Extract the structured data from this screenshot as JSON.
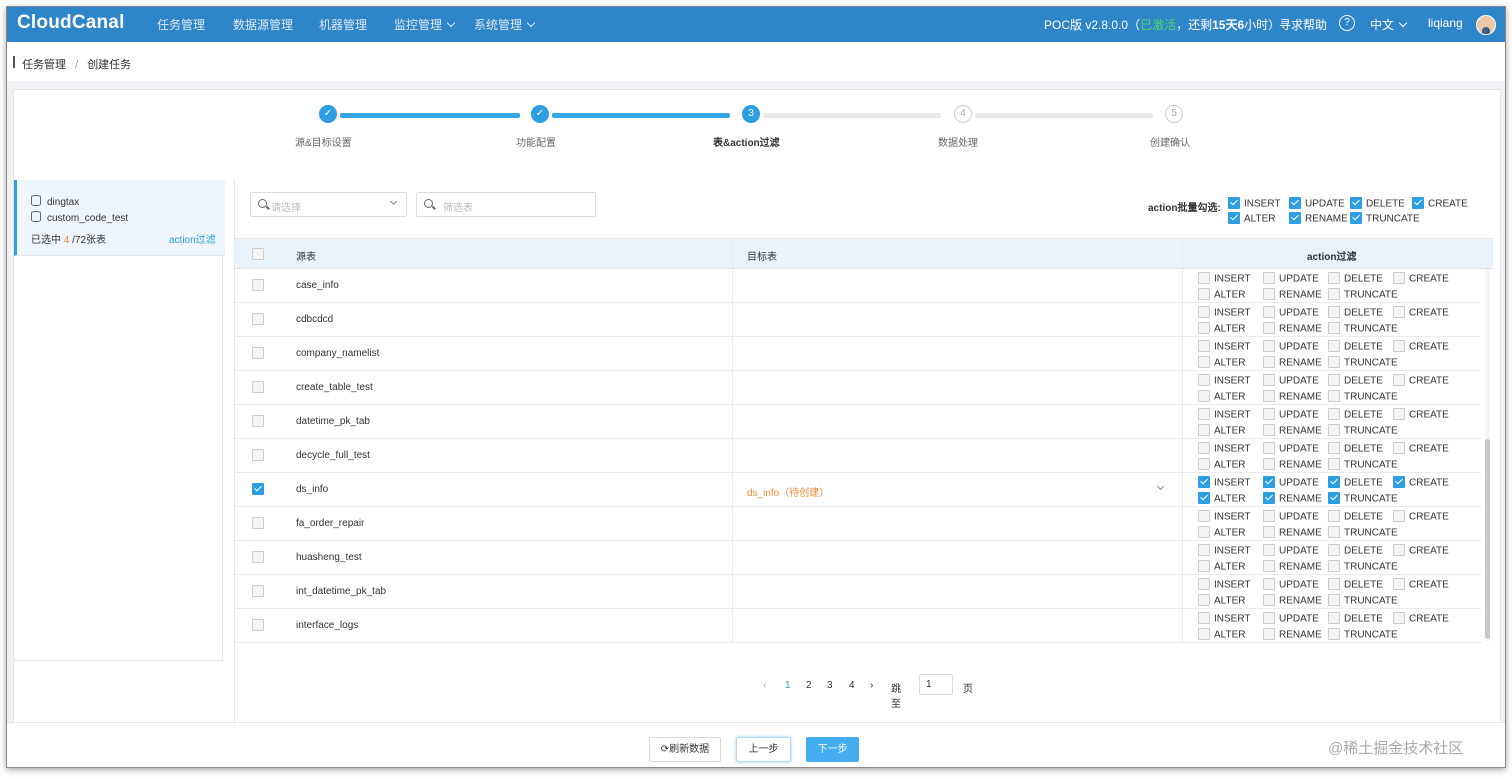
{
  "app": {
    "logo": "CloudCanal",
    "nav": [
      {
        "label": "任务管理",
        "active": true,
        "has_menu": false
      },
      {
        "label": "数据源管理",
        "active": false,
        "has_menu": false
      },
      {
        "label": "机器管理",
        "active": false,
        "has_menu": false
      },
      {
        "label": "监控管理",
        "active": false,
        "has_menu": true
      },
      {
        "label": "系统管理",
        "active": false,
        "has_menu": true
      }
    ],
    "version": "POC版 v2.8.0.0",
    "license_open": "（",
    "license_status": "已激活",
    "license_mid": "，还剩",
    "license_days": "15天6",
    "license_unit": "小时）",
    "help": "寻求帮助",
    "help_icon": "?",
    "language": "中文",
    "user": "liqiang"
  },
  "breadcrumb": {
    "root": "任务管理",
    "sep": "/",
    "current": "创建任务"
  },
  "steps": [
    {
      "num": "✓",
      "label": "源&目标设置",
      "state": "done"
    },
    {
      "num": "✓",
      "label": "功能配置",
      "state": "done"
    },
    {
      "num": "3",
      "label": "表&action过滤",
      "state": "cur"
    },
    {
      "num": "4",
      "label": "数据处理",
      "state": "todo"
    },
    {
      "num": "5",
      "label": "创建确认",
      "state": "todo"
    }
  ],
  "left_panel": {
    "db_name": "dingtax",
    "schema_name": "custom_code_test",
    "selected_prefix": "已选中",
    "selected_count": "4",
    "selected_suffix": "/72张表",
    "action_link": "action过滤"
  },
  "filters": {
    "select_placeholder": "请选择",
    "filter_placeholder": "筛选表"
  },
  "batch": {
    "label": "action批量勾选:",
    "actions": [
      {
        "label": "INSERT",
        "checked": true
      },
      {
        "label": "UPDATE",
        "checked": true
      },
      {
        "label": "DELETE",
        "checked": true
      },
      {
        "label": "CREATE",
        "checked": true
      },
      {
        "label": "ALTER",
        "checked": true
      },
      {
        "label": "RENAME",
        "checked": true
      },
      {
        "label": "TRUNCATE",
        "checked": true
      }
    ]
  },
  "table": {
    "headers": {
      "source": "源表",
      "target": "目标表",
      "action": "action过滤"
    },
    "action_labels": [
      "INSERT",
      "UPDATE",
      "DELETE",
      "CREATE",
      "ALTER",
      "RENAME",
      "TRUNCATE"
    ],
    "rows": [
      {
        "source": "case_info",
        "target": "",
        "selected": false
      },
      {
        "source": "cdbcdcd",
        "target": "",
        "selected": false
      },
      {
        "source": "company_namelist",
        "target": "",
        "selected": false
      },
      {
        "source": "create_table_test",
        "target": "",
        "selected": false
      },
      {
        "source": "datetime_pk_tab",
        "target": "",
        "selected": false
      },
      {
        "source": "decycle_full_test",
        "target": "",
        "selected": false
      },
      {
        "source": "ds_info",
        "target": "ds_info（待创建）",
        "selected": true
      },
      {
        "source": "fa_order_repair",
        "target": "",
        "selected": false
      },
      {
        "source": "huasheng_test",
        "target": "",
        "selected": false
      },
      {
        "source": "int_datetime_pk_tab",
        "target": "",
        "selected": false
      },
      {
        "source": "interface_logs",
        "target": "",
        "selected": false
      }
    ]
  },
  "pagination": {
    "prev": "‹",
    "pages": [
      "1",
      "2",
      "3",
      "4"
    ],
    "current": "1",
    "next": "›",
    "goto_label": "跳至",
    "goto_value": "1",
    "page_unit": "页"
  },
  "footer": {
    "refresh": "⟳刷新数据",
    "prev": "上一步",
    "next": "下一步"
  },
  "watermark": "@稀土掘金技术社区",
  "colors": {
    "accent": "#2e9ee3",
    "topbar": "#2e86c9",
    "warning": "#f08c3c",
    "active_green": "#53d36b"
  }
}
